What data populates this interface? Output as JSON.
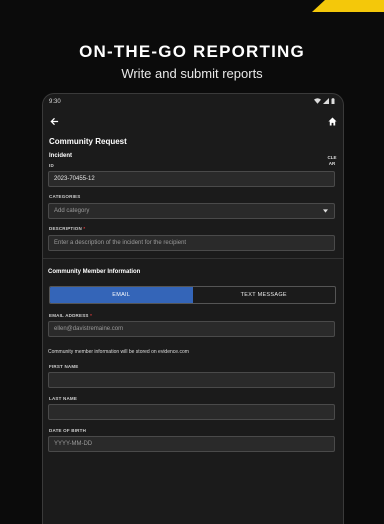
{
  "banner": {
    "headline": "ON-THE-GO REPORTING",
    "subhead": "Write and submit reports"
  },
  "status": {
    "time": "9:30"
  },
  "form": {
    "title": "Community Request",
    "incident_label": "Incident",
    "id_label": "ID",
    "clear_label": "CLE AR",
    "id_value": "2023-70455-12",
    "categories_label": "CATEGORIES",
    "categories_placeholder": "Add category",
    "description_label": "DESCRIPTION",
    "required_mark": "*",
    "description_placeholder": "Enter a description of the incident for the recipient",
    "community_section": "Community Member Information",
    "tabs": [
      {
        "label": "EMAIL",
        "active": true
      },
      {
        "label": "TEXT MESSAGE",
        "active": false
      }
    ],
    "email_label": "EMAIL ADDRESS",
    "email_placeholder": "ellen@davistremaine.com",
    "storage_note": "Community member information will be stored on evidence.com",
    "first_name_label": "FIRST NAME",
    "first_name_value": "",
    "last_name_label": "LAST NAME",
    "last_name_value": "",
    "dob_label": "DATE OF BIRTH",
    "dob_placeholder": "YYYY-MM-DD"
  },
  "colors": {
    "accent_yellow": "#f4c80a",
    "tab_active": "#3465b8",
    "required": "#e23b3b"
  },
  "icons": [
    "back-arrow-icon",
    "home-icon",
    "chevron-down-icon",
    "wifi-icon",
    "signal-icon",
    "battery-icon"
  ]
}
